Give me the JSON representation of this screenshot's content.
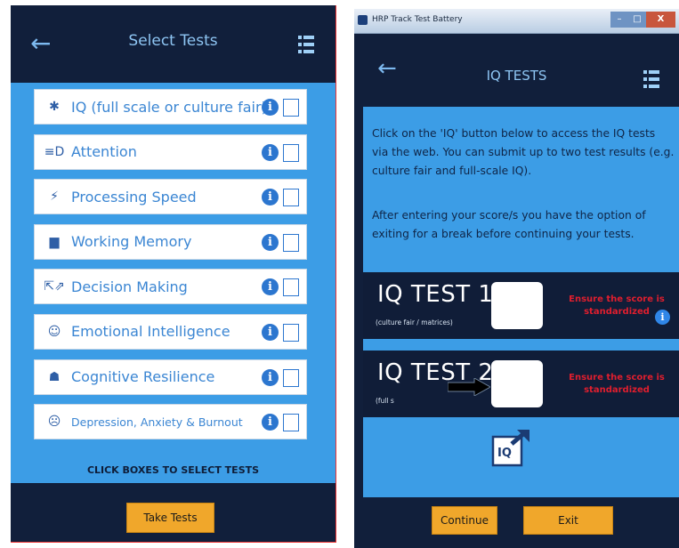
{
  "left": {
    "header": {
      "back": "←",
      "title": "Select Tests"
    },
    "tests": [
      {
        "label": "IQ (full scale or culture fair)",
        "icon": "puzzle-icon",
        "glyph": "✱",
        "small": false
      },
      {
        "label": "Attention",
        "icon": "attention-icon",
        "glyph": "≡D",
        "small": false
      },
      {
        "label": "Processing Speed",
        "icon": "lightning-icon",
        "glyph": "⚡",
        "small": false
      },
      {
        "label": "Working Memory",
        "icon": "memory-icon",
        "glyph": "▆",
        "small": false
      },
      {
        "label": "Decision Making",
        "icon": "arrows-icon",
        "glyph": "⇱⇗",
        "small": false
      },
      {
        "label": "Emotional Intelligence",
        "icon": "smiley-icon",
        "glyph": "☺",
        "small": false
      },
      {
        "label": "Cognitive Resilience",
        "icon": "head-icon",
        "glyph": "☗",
        "small": false
      },
      {
        "label": "Depression, Anxiety & Burnout",
        "icon": "sad-face-icon",
        "glyph": "☹",
        "small": true
      }
    ],
    "info_glyph": "i",
    "hint": "CLICK BOXES TO SELECT TESTS",
    "take_tests": "Take Tests"
  },
  "right": {
    "window_title": "HRP Track Test Battery",
    "win_min": "–",
    "win_max": "□",
    "win_close": "X",
    "header": {
      "back": "←",
      "title": "IQ TESTS"
    },
    "para1": "Click on the 'IQ' button below to access the IQ tests via the web. You can submit up to two test results (e.g. culture fair and full-scale IQ).",
    "para2": "After entering your score/s you have the option of exiting for a break before continuing your tests.",
    "iq1": {
      "label": "IQ TEST 1",
      "sub": "(culture fair / matrices)",
      "warn": "Ensure the score is standardized"
    },
    "iq2": {
      "label": "IQ TEST 2",
      "sub": "(full s",
      "warn": "Ensure the score is standardized"
    },
    "info_glyph": "i",
    "continue": "Continue",
    "exit": "Exit"
  }
}
